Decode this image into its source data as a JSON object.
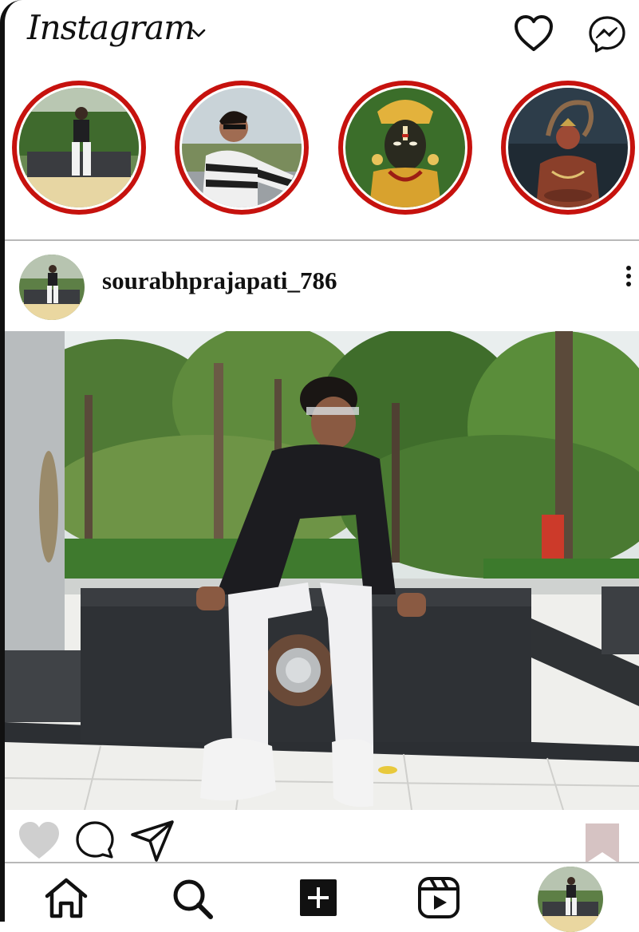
{
  "app": {
    "logo_text": "Instagram",
    "accent_color": "#c6120e"
  },
  "header": {
    "icons": [
      "chevron-down-icon",
      "heart-icon",
      "messenger-icon"
    ]
  },
  "stories": [
    {
      "id": "story-1",
      "subject": "man sitting in park"
    },
    {
      "id": "story-2",
      "subject": "man in striped sweater"
    },
    {
      "id": "story-3",
      "subject": "deity idol"
    },
    {
      "id": "story-4",
      "subject": "deity artwork"
    }
  ],
  "post": {
    "username": "sourabhprajapati_786",
    "actions": [
      "heart-icon",
      "comment-icon",
      "share-icon",
      "bookmark-icon"
    ]
  },
  "bottom_nav": {
    "items": [
      "home-icon",
      "search-icon",
      "add-post-icon",
      "reels-icon",
      "profile-avatar"
    ]
  }
}
